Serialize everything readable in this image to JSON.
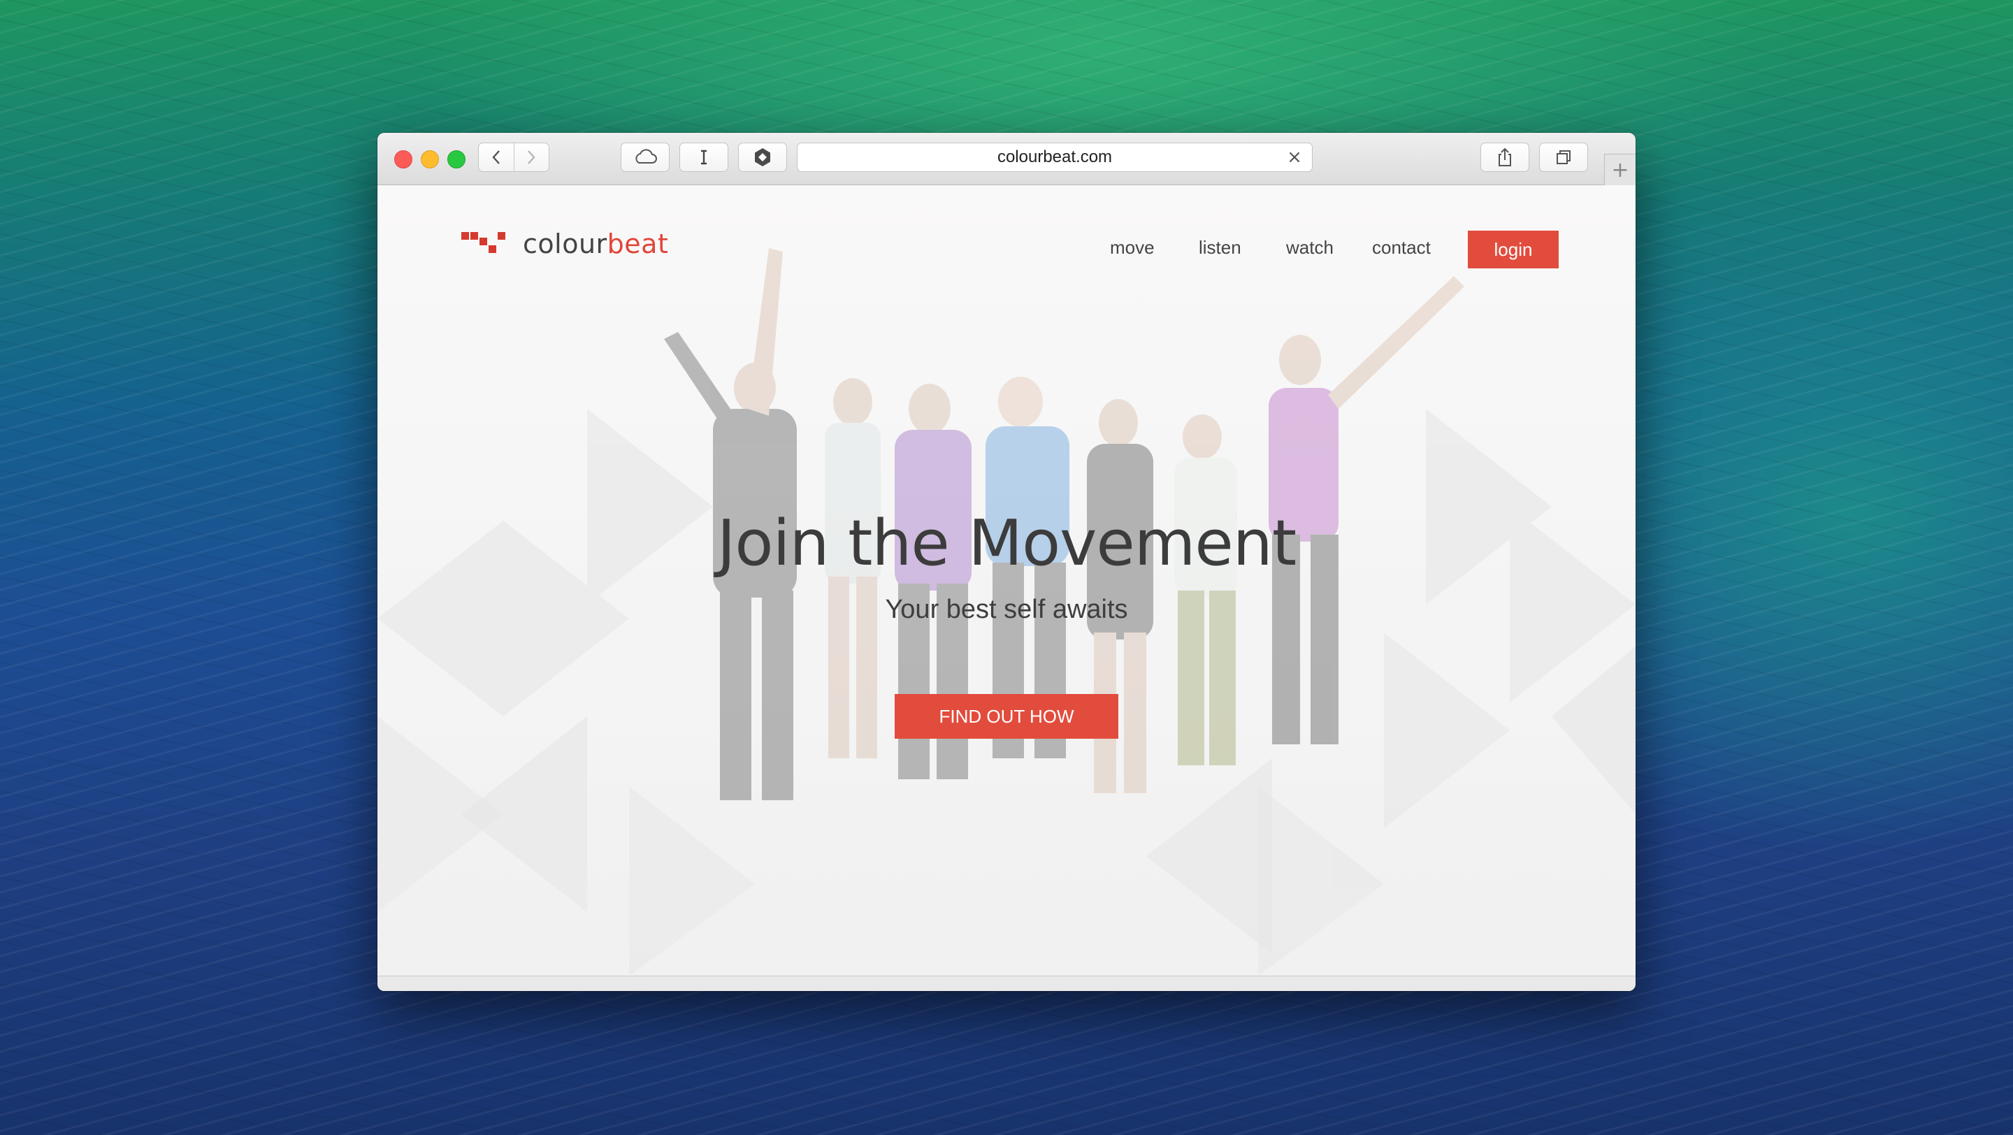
{
  "browser": {
    "url": "colourbeat.com",
    "clear_glyph": "×",
    "new_tab_glyph": "+"
  },
  "site": {
    "logo_prefix": "colour",
    "logo_suffix": "beat",
    "nav": [
      "move",
      "listen",
      "watch",
      "contact"
    ],
    "login_label": "login",
    "headline": "Join the Movement",
    "subheadline": "Your best self awaits",
    "cta_label": "FIND OUT HOW"
  },
  "colors": {
    "brand_red": "#e24c3d",
    "text_dark": "#3c3c3c"
  },
  "icons": [
    "back-arrow-icon",
    "forward-arrow-icon",
    "cloud-icon",
    "reader-icon",
    "extension-icon",
    "share-icon",
    "tabs-icon",
    "close-icon"
  ]
}
